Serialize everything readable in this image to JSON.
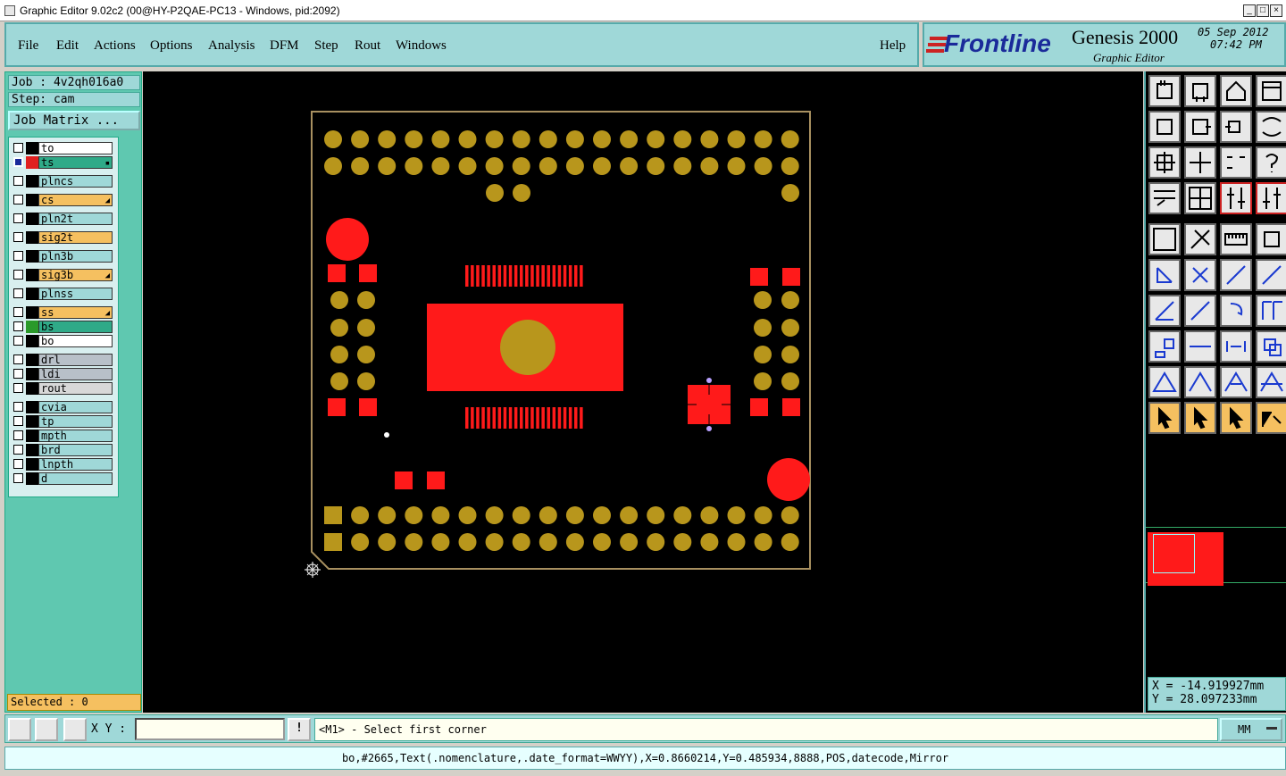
{
  "window": {
    "title": "Graphic Editor 9.02c2 (00@HY-P2QAE-PC13 - Windows, pid:2092)"
  },
  "menu": {
    "items": [
      "File",
      "Edit",
      "Actions",
      "Options",
      "Analysis",
      "DFM",
      "Step",
      "Rout",
      "Windows"
    ],
    "help": "Help"
  },
  "brand": {
    "logo": "Frontline",
    "product": "Genesis 2000",
    "subtitle": "Graphic Editor",
    "date": "05 Sep 2012",
    "time": "07:42 PM"
  },
  "job": {
    "job_label": "Job : 4v2qh016a0",
    "step_label": "Step: cam",
    "matrix_button": "Job Matrix ..."
  },
  "layers": [
    {
      "name": "to",
      "color": "#ffffff",
      "swatch": "#000000"
    },
    {
      "name": "ts",
      "color": "#2faa88",
      "swatch": "#e02020",
      "checked": true,
      "mark": "▪"
    },
    {
      "name": "plncs",
      "color": "#9fd8d8",
      "swatch": "#000000"
    },
    {
      "name": "cs",
      "color": "#f5c060",
      "swatch": "#000000",
      "mark": "◢"
    },
    {
      "name": "pln2t",
      "color": "#9fd8d8",
      "swatch": "#000000"
    },
    {
      "name": "sig2t",
      "color": "#f5c060",
      "swatch": "#000000"
    },
    {
      "name": "pln3b",
      "color": "#9fd8d8",
      "swatch": "#000000"
    },
    {
      "name": "sig3b",
      "color": "#f5c060",
      "swatch": "#000000",
      "mark": "◢"
    },
    {
      "name": "plnss",
      "color": "#9fd8d8",
      "swatch": "#000000"
    },
    {
      "name": "ss",
      "color": "#f5c060",
      "swatch": "#000000",
      "mark": "◢"
    },
    {
      "name": "bs",
      "color": "#2faa88",
      "swatch": "#2a9a2a"
    },
    {
      "name": "bo",
      "color": "#ffffff",
      "swatch": "#000000"
    },
    {
      "name": "drl",
      "color": "#b8c0c8",
      "swatch": "#000000"
    },
    {
      "name": "ldi",
      "color": "#b8c0c8",
      "swatch": "#000000"
    },
    {
      "name": "rout",
      "color": "#d8d8d8",
      "swatch": "#000000"
    },
    {
      "name": "cvia",
      "color": "#9fd8d8",
      "swatch": "#000000"
    },
    {
      "name": "tp",
      "color": "#9fd8d8",
      "swatch": "#000000"
    },
    {
      "name": "mpth",
      "color": "#9fd8d8",
      "swatch": "#000000"
    },
    {
      "name": "brd",
      "color": "#9fd8d8",
      "swatch": "#000000"
    },
    {
      "name": "lnpth",
      "color": "#9fd8d8",
      "swatch": "#000000"
    },
    {
      "name": "d",
      "color": "#9fd8d8",
      "swatch": "#000000"
    }
  ],
  "selection": {
    "label": "Selected : 0"
  },
  "coords": {
    "x": "X = -14.919927mm",
    "y": "Y =  28.097233mm"
  },
  "command": {
    "xy_label": "X Y :",
    "xy_value": "",
    "prompt": "<M1> - Select first corner",
    "units": "MM"
  },
  "status": {
    "text": "bo,#2665,Text(.nomenclature,.date_format=WWYY),X=0.8660214,Y=0.485934,8888,POS,datecode,Mirror"
  },
  "colors": {
    "copper": "#b8961c",
    "mask": "#ff1a1a",
    "panel": "#9fd8d8",
    "canvas": "#000000"
  },
  "toolbar_icons": [
    "open-icon",
    "save-icon",
    "home-icon",
    "window-icon",
    "zoom-in-icon",
    "zoom-out-icon",
    "undo-zoom-icon",
    "redraw-icon",
    "fit-icon",
    "center-icon",
    "scale-1-2-icon",
    "help-icon",
    "settings-icon",
    "grid-icon",
    "snap-icon",
    "layer-icon",
    "fill-icon",
    "outline-icon",
    "ruler-icon",
    "pad-icon",
    "node-icon",
    "delete-icon",
    "line-icon",
    "route-icon",
    "measure-icon",
    "draw-icon",
    "rotate-icon",
    "mirror-icon",
    "copy-icon",
    "move-icon",
    "stretch-icon",
    "resize-icon",
    "triangle-icon",
    "angle-icon",
    "arc-icon",
    "polygon-icon",
    "select-icon",
    "select-box-icon",
    "select-area-icon",
    "net-icon"
  ]
}
